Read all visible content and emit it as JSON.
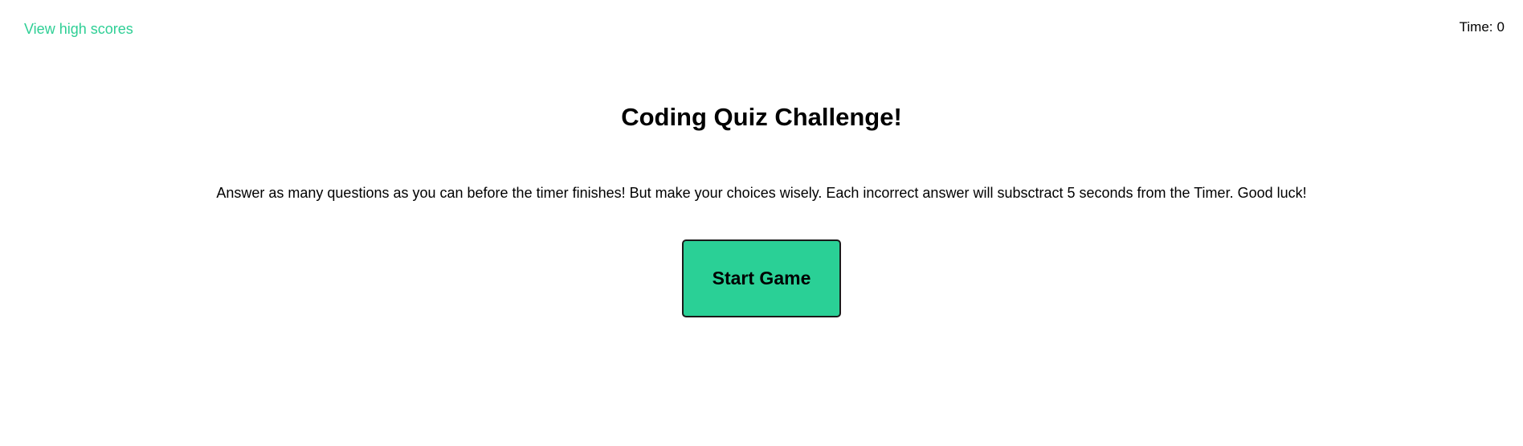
{
  "header": {
    "high_scores_link": "View high scores",
    "timer_label": "Time:",
    "timer_value": "0"
  },
  "main": {
    "title": "Coding Quiz Challenge!",
    "instructions": "Answer as many questions as you can before the timer finishes! But make your choices wisely. Each incorrect answer will subsctract 5 seconds from the Timer. Good luck!",
    "start_button_label": "Start Game"
  },
  "colors": {
    "accent": "#2ad096",
    "link": "#2ecf95",
    "text": "#000000",
    "background": "#ffffff"
  }
}
